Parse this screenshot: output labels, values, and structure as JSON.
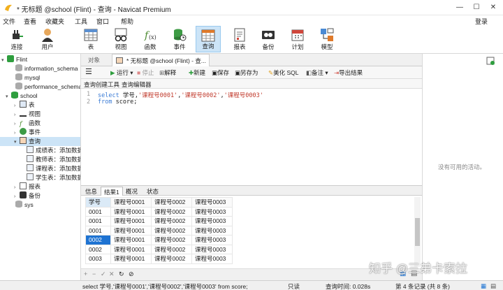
{
  "window": {
    "title": "* 无标题 @school (Flint) - 查询 - Navicat Premium"
  },
  "menu": [
    "文件",
    "查看",
    "收藏夹",
    "工具",
    "窗口",
    "帮助"
  ],
  "login": "登录",
  "toolbar": [
    "连接",
    "用户",
    "表",
    "视图",
    "函数",
    "事件",
    "查询",
    "报表",
    "备份",
    "计划",
    "模型"
  ],
  "tree": {
    "connection": "Flint",
    "databases": [
      "information_schema",
      "mysql",
      "performance_schema",
      "school",
      "sys"
    ],
    "school_children": [
      "表",
      "视图",
      "函数",
      "事件",
      "查询"
    ],
    "queries": [
      "成绩表：添加数据",
      "教师表：添加数据",
      "课程表：添加数据",
      "学生表：添加数据"
    ],
    "school_more": [
      "报表",
      "备份"
    ]
  },
  "tabs": {
    "object": "对象",
    "query": "* 无标题 @school (Flint) - 查..."
  },
  "query_toolbar": {
    "run": "运行",
    "stop": "停止",
    "explain": "解释",
    "new": "新建",
    "save": "保存",
    "save_as": "另存为",
    "beautify": "美化 SQL",
    "notes": "备注",
    "export": "导出结果"
  },
  "subtabs": [
    "查询创建工具",
    "查询编辑器"
  ],
  "editor": {
    "line_numbers": [
      "1",
      "2"
    ],
    "line1": {
      "kw": "select",
      "col": " 学号,",
      "s1": "'课程号0001'",
      "c1": ",",
      "s2": "'课程号0002'",
      "c2": ",",
      "s3": "'课程号0003'"
    },
    "line2": {
      "kw": "from",
      "rest": " score;"
    }
  },
  "result_tabs": [
    "信息",
    "结果1",
    "概况",
    "状态"
  ],
  "result": {
    "columns": [
      "学号",
      "课程号0001",
      "课程号0002",
      "课程号0003"
    ],
    "rows": [
      [
        "0001",
        "课程号0001",
        "课程号0002",
        "课程号0003"
      ],
      [
        "0001",
        "课程号0001",
        "课程号0002",
        "课程号0003"
      ],
      [
        "0001",
        "课程号0001",
        "课程号0002",
        "课程号0003"
      ],
      [
        "0002",
        "课程号0001",
        "课程号0002",
        "课程号0003"
      ],
      [
        "0002",
        "课程号0001",
        "课程号0002",
        "课程号0003"
      ],
      [
        "0003",
        "课程号0001",
        "课程号0002",
        "课程号0003"
      ]
    ]
  },
  "right_panel": {
    "empty_text": "没有可用的活动。"
  },
  "status": {
    "sql": "select 学号,'课程号0001','课程号0002','课程号0003' from score;",
    "mode": "只读",
    "time": "查询时间: 0.028s",
    "record": "第 4 条记录 (共 8 条)"
  },
  "watermark": "知乎 @三弟卡索拉",
  "colors": {
    "selection": "#1e73d2",
    "keyword": "#3a7bd5",
    "string": "#c0392b",
    "active_tab": "#cce4f7"
  }
}
